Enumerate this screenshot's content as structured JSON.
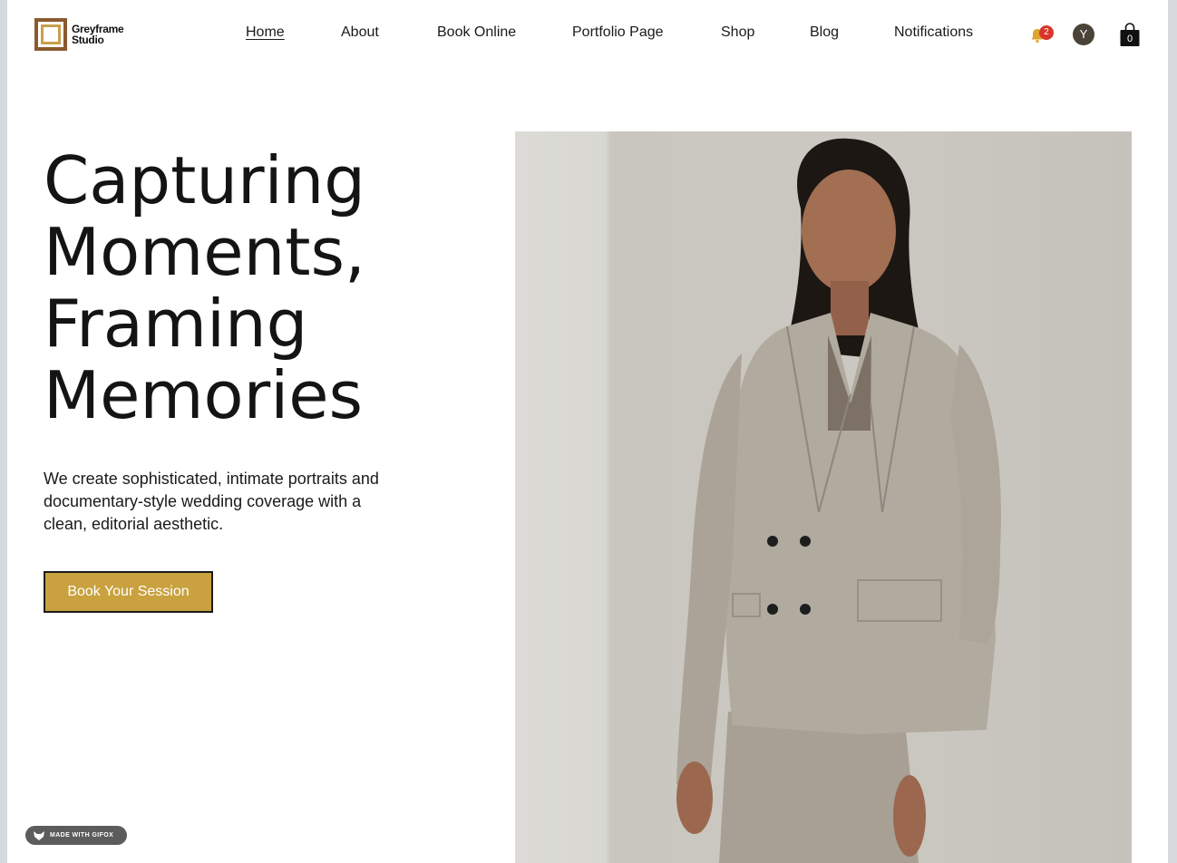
{
  "brand": {
    "line1": "Greyframe",
    "line2": "Studio"
  },
  "nav": {
    "items": [
      {
        "label": "Home",
        "active": true
      },
      {
        "label": "About"
      },
      {
        "label": "Book Online"
      },
      {
        "label": "Portfolio Page"
      },
      {
        "label": "Shop"
      },
      {
        "label": "Blog"
      },
      {
        "label": "Notifications"
      }
    ]
  },
  "header": {
    "notification_count": "2",
    "avatar_initial": "Y",
    "cart_count": "0",
    "icons": [
      "bell-icon",
      "cart-icon"
    ]
  },
  "hero": {
    "title_lines": [
      "Capturing",
      "Moments,",
      "Framing",
      "Memories"
    ],
    "text": "We create sophisticated, intimate portraits and documentary-style wedding coverage with a clean, editorial aesthetic.",
    "cta_label": "Book Your Session"
  },
  "badge": {
    "label": "MADE WITH GIFOX"
  },
  "colors": {
    "accent": "#c9a13e",
    "badge_red": "#d8352a",
    "avatar_bg": "#4b4238",
    "logo_outer": "#8a5a2e"
  }
}
